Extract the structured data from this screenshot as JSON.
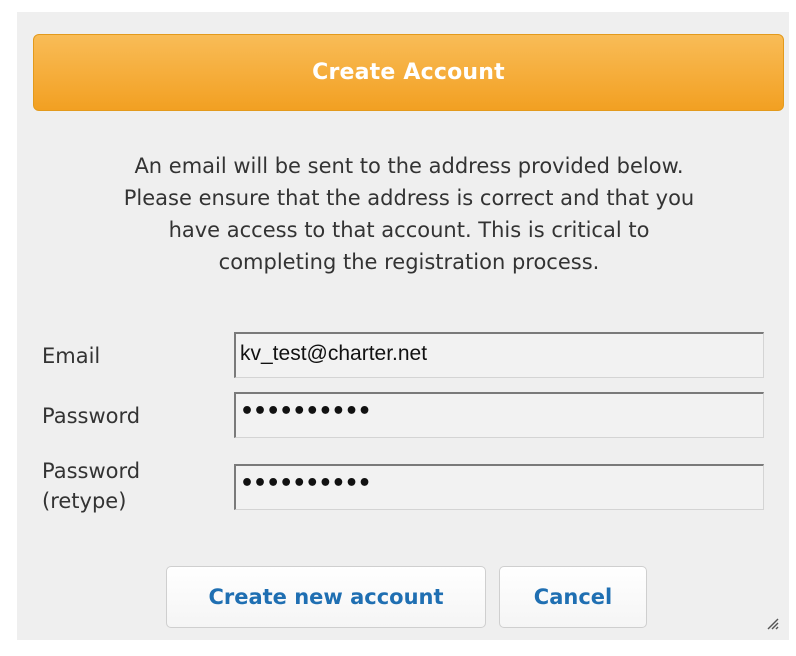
{
  "dialog": {
    "title": "Create Account",
    "message_lines": [
      "An email will be sent to the address provided below.",
      "Please ensure that the address is correct and that you",
      "have access to that account. This is critical to",
      "completing the registration process."
    ]
  },
  "form": {
    "email": {
      "label": "Email",
      "value": "kv_test@charter.net"
    },
    "password": {
      "label": "Password",
      "value": "••••••••••"
    },
    "password_retype": {
      "label_line1": "Password",
      "label_line2": "(retype)",
      "value": "••••••••••"
    }
  },
  "buttons": {
    "create_label": "Create new account",
    "cancel_label": "Cancel"
  },
  "icons": {
    "resize": "resize-grip-icon"
  },
  "colors": {
    "title_bar": "#f2a022",
    "button_text": "#1f6fb2",
    "dialog_bg": "#efefef"
  }
}
